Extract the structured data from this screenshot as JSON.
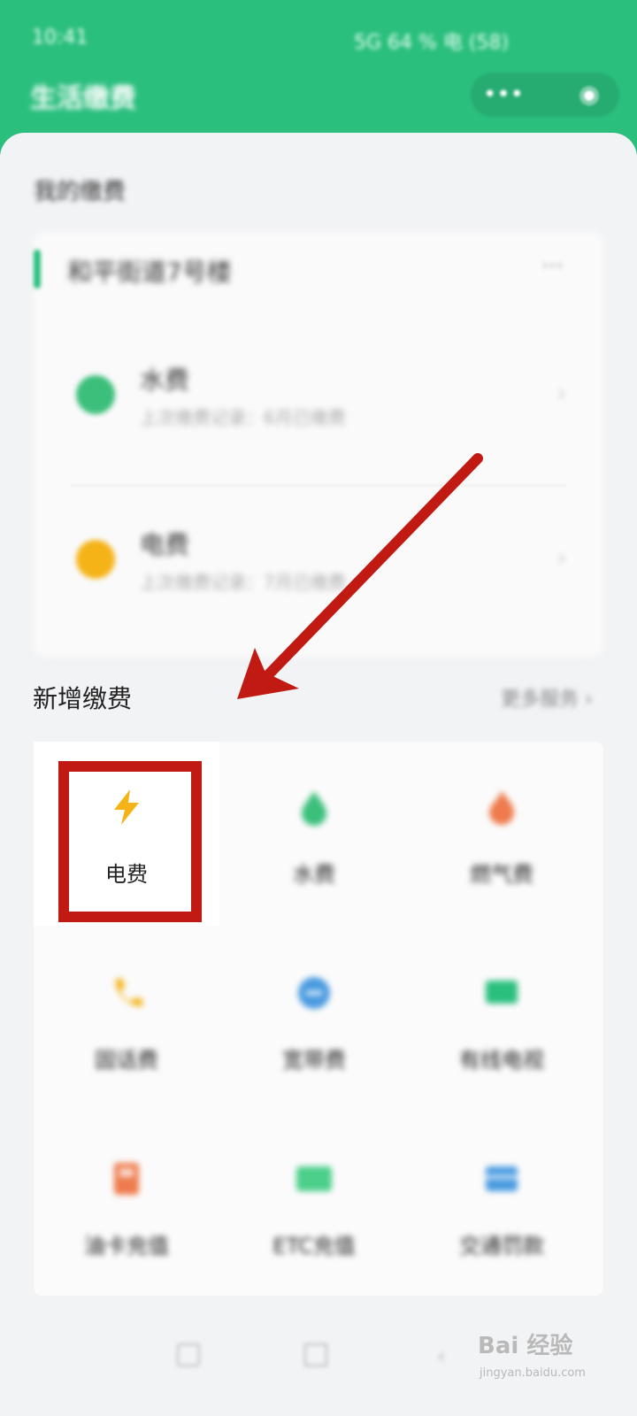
{
  "status_bar": {
    "time": "10:41",
    "right": "5G 64 % 电 (58)"
  },
  "header": {
    "title": "生活缴费",
    "more_icon": "more-dots-icon",
    "close_icon": "target-close-icon"
  },
  "colors": {
    "brand_green": "#2bbf7e",
    "highlight_red": "#c01a12",
    "electric_yellow": "#f5b317",
    "water_green": "#3bbf7a",
    "gas_orange": "#ee7b4d"
  },
  "my_bills": {
    "title": "我的缴费",
    "address": "和平街道7号楼",
    "address_more": "···",
    "items": [
      {
        "title": "水费",
        "subtitle": "上次缴费记录：6月已缴费",
        "icon": "water-drop-icon"
      },
      {
        "title": "电费",
        "subtitle": "上次缴费记录：7月已缴费",
        "icon": "lightning-icon"
      }
    ]
  },
  "add_section": {
    "title": "新增缴费",
    "right_link": "更多服务 ›",
    "items": [
      {
        "label": "电费",
        "icon": "lightning-icon"
      },
      {
        "label": "水费",
        "icon": "water-drop-icon"
      },
      {
        "label": "燃气费",
        "icon": "flame-icon"
      },
      {
        "label": "固话费",
        "icon": "phone-icon"
      },
      {
        "label": "宽带费",
        "icon": "broadband-icon"
      },
      {
        "label": "有线电视",
        "icon": "tv-icon"
      },
      {
        "label": "油卡充值",
        "icon": "fuel-card-icon"
      },
      {
        "label": "ETC充值",
        "icon": "etc-card-icon"
      },
      {
        "label": "交通罚款",
        "icon": "traffic-fine-icon"
      }
    ]
  },
  "watermark": {
    "brand": "Bai 经验",
    "url": "jingyan.baidu.com"
  }
}
